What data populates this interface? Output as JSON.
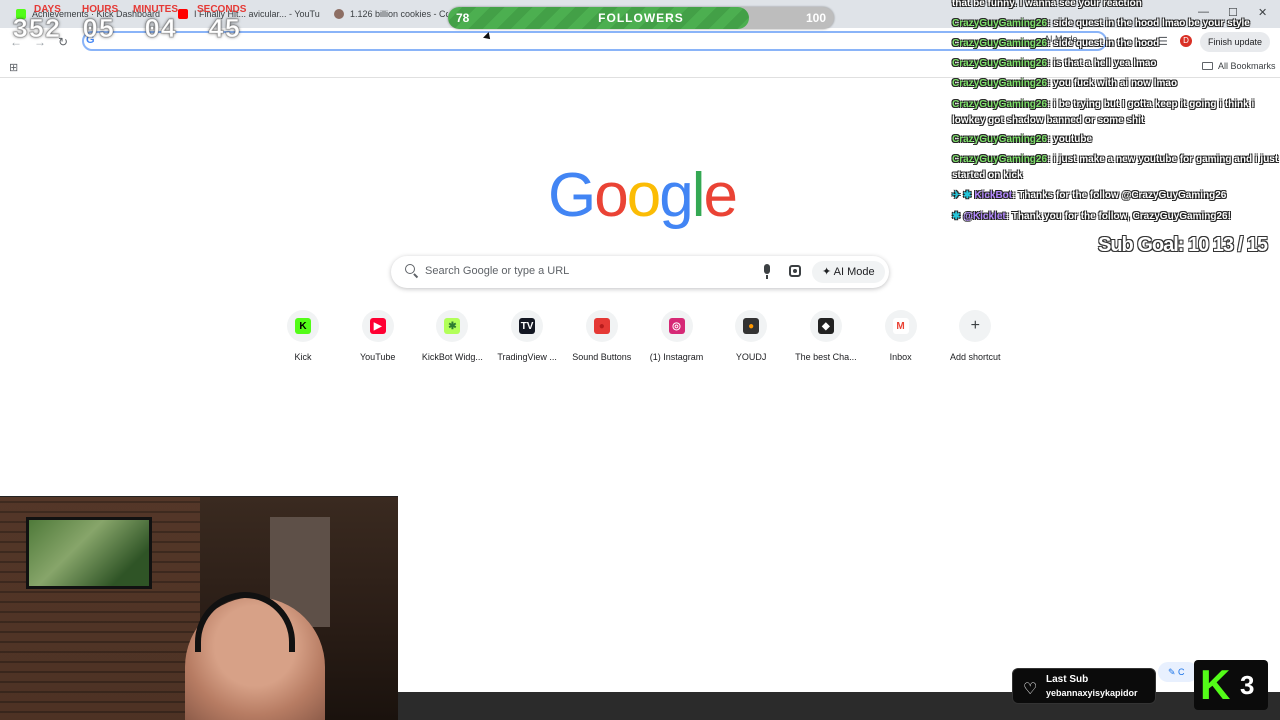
{
  "tabs": [
    {
      "label": "Achievements · Kick Dashboard",
      "favicon_color": "#53fc18"
    },
    {
      "label": "I Finally Hit... avicular... - YouTu",
      "favicon_color": "#ff0000"
    },
    {
      "label": "1.126 billion cookies - Cooki",
      "favicon_color": "#8d6e63"
    }
  ],
  "window_controls": {
    "minimize": "—",
    "maximize": "☐",
    "close": "✕"
  },
  "toolbar": {
    "back": "←",
    "forward": "→",
    "reload": "↻",
    "omnibox_g": "G",
    "ai_mode_chip": "AI Mode",
    "profile_letter": "D",
    "finish_update": "Finish update"
  },
  "bookmarks_bar": {
    "all_bookmarks": "All Bookmarks"
  },
  "google": {
    "letters": [
      {
        "ch": "G",
        "color": "#4285f4"
      },
      {
        "ch": "o",
        "color": "#ea4335"
      },
      {
        "ch": "o",
        "color": "#fbbc05"
      },
      {
        "ch": "g",
        "color": "#4285f4"
      },
      {
        "ch": "l",
        "color": "#34a853"
      },
      {
        "ch": "e",
        "color": "#ea4335"
      }
    ],
    "search_placeholder": "Search Google or type a URL",
    "ai_mode_button": "AI Mode"
  },
  "shortcuts": [
    {
      "label": "Kick",
      "icon": "kick-icon",
      "glyph": "K",
      "color": "#53fc18",
      "text_color": "#000000"
    },
    {
      "label": "YouTube",
      "icon": "youtube-icon",
      "glyph": "▶",
      "color": "#ff0033",
      "text_color": "#ffffff"
    },
    {
      "label": "KickBot Widg...",
      "icon": "kickbot-icon",
      "glyph": "✱",
      "color": "#b2ff59",
      "text_color": "#2e7d32"
    },
    {
      "label": "TradingView ...",
      "icon": "tradingview-icon",
      "glyph": "TV",
      "color": "#131722",
      "text_color": "#ffffff"
    },
    {
      "label": "Sound Buttons",
      "icon": "red-button-icon",
      "glyph": "●",
      "color": "#e53935",
      "text_color": "#b71c1c"
    },
    {
      "label": "(1) Instagram",
      "icon": "instagram-icon",
      "glyph": "◎",
      "color": "#d62976",
      "text_color": "#ffffff"
    },
    {
      "label": "YOUDJ",
      "icon": "youdj-icon",
      "glyph": "●",
      "color": "#333333",
      "text_color": "#ff9800"
    },
    {
      "label": "The best Cha...",
      "icon": "chat-app-icon",
      "glyph": "◆",
      "color": "#222222",
      "text_color": "#ffffff"
    },
    {
      "label": "Inbox",
      "icon": "gmail-icon",
      "glyph": "M",
      "color": "#ffffff",
      "text_color": "#ea4335"
    },
    {
      "label": "Add shortcut",
      "icon": "plus-icon",
      "glyph": "+",
      "color": "transparent",
      "text_color": "#3c4043"
    }
  ],
  "countdown": {
    "labels": [
      "DAYS",
      "HOURS",
      "MINUTES",
      "SECONDS"
    ],
    "values": [
      "352",
      "05",
      "04",
      "45"
    ]
  },
  "followers_goal": {
    "current": 78,
    "title": "FOLLOWERS",
    "goal": 100,
    "fill_fraction": 0.78
  },
  "chat": [
    {
      "user": "",
      "text": "that be funny. I wanna see your reaction",
      "type": "plain"
    },
    {
      "user": "CrazyGuyGaming26",
      "text": "side quest in the hood lmao be your style",
      "type": "user"
    },
    {
      "user": "CrazyGuyGaming26",
      "text": "side quest in the hood",
      "type": "user"
    },
    {
      "user": "CrazyGuyGaming26",
      "text": "is that a hell yea lmao",
      "type": "user"
    },
    {
      "user": "CrazyGuyGaming26",
      "text": "you fuck with ai now lmao",
      "type": "user"
    },
    {
      "user": "CrazyGuyGaming26",
      "text": "i be trying but I gotta keep it going i think i lowkey got shadow banned or some shit",
      "type": "user"
    },
    {
      "user": "CrazyGuyGaming26",
      "text": "youtube",
      "type": "user"
    },
    {
      "user": "CrazyGuyGaming26",
      "text": "i just make a new youtube for gaming and i just started on kick",
      "type": "user"
    },
    {
      "user": "KickBot",
      "text": "Thanks for the follow @CrazyGuyGaming26",
      "type": "bot"
    },
    {
      "user": "@Kicklet",
      "text": "Thank you for the follow, CrazyGuyGaming26!",
      "type": "bot2"
    }
  ],
  "sub_goal": "Sub Goal: 10  13 / 15",
  "last_sub": {
    "title": "Last Sub",
    "name": "yebannaxyisykapidor"
  },
  "customize": "C",
  "kick_badge": {
    "letter": "K",
    "count": "3"
  }
}
